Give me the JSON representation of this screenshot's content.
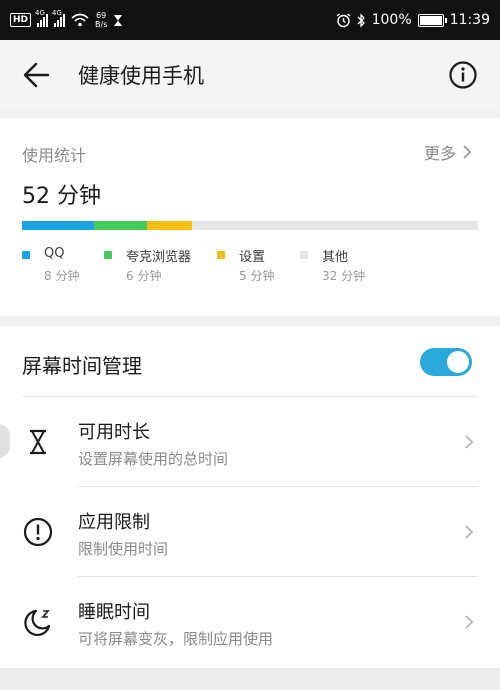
{
  "status_bar": {
    "hd": "HD",
    "network_speed_value": "69",
    "network_speed_unit": "B/s",
    "battery": "100%",
    "time": "11:39",
    "icons": [
      "signal-icon",
      "wifi-icon",
      "hourglass-icon",
      "alarm-icon",
      "bluetooth-icon",
      "battery-icon"
    ]
  },
  "header": {
    "title": "健康使用手机",
    "back_icon": "arrow-left-icon",
    "info_icon": "info-icon"
  },
  "stats": {
    "label": "使用统计",
    "more": "更多",
    "total": "52 分钟",
    "segments": [
      {
        "name": "QQ",
        "minutes_label": "8 分钟",
        "minutes": 8,
        "color": "#1aa5e0"
      },
      {
        "name": "夸克浏览器",
        "minutes_label": "6 分钟",
        "minutes": 6,
        "color": "#48c95c"
      },
      {
        "name": "设置",
        "minutes_label": "5 分钟",
        "minutes": 5,
        "color": "#f4be12"
      },
      {
        "name": "其他",
        "minutes_label": "32 分钟",
        "minutes": 32,
        "color": "#e6e6e6"
      }
    ]
  },
  "management": {
    "title": "屏幕时间管理",
    "toggle_on": true,
    "accent": "#2aa7db",
    "items": [
      {
        "title": "可用时长",
        "subtitle": "设置屏幕使用的总时间",
        "icon": "hourglass-icon"
      },
      {
        "title": "应用限制",
        "subtitle": "限制使用时间",
        "icon": "exclamation-circle-icon"
      },
      {
        "title": "睡眠时间",
        "subtitle": "可将屏幕变灰，限制应用使用",
        "icon": "moon-icon"
      }
    ]
  }
}
